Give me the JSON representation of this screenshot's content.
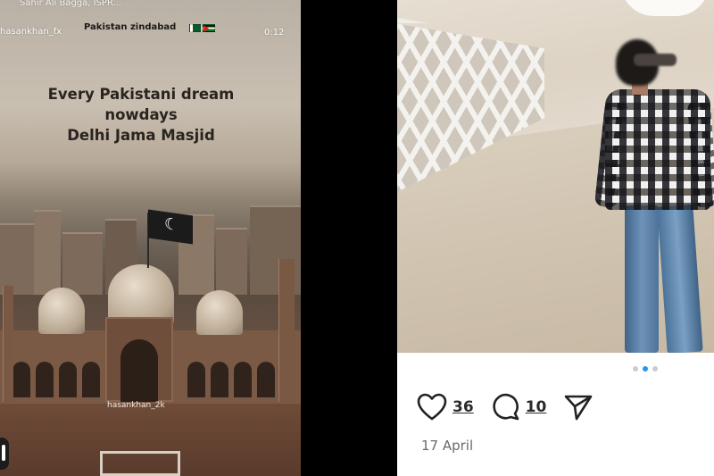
{
  "story": {
    "music_line": "Sahir Ali Bagga, ISPR...",
    "username": "hasankhan_fx",
    "caption": "Pakistan zindabad",
    "time": "0:12",
    "headline": [
      "Every Pakistani dream",
      "nowdays",
      "Delhi Jama Masjid"
    ],
    "watermark": "hasankhan_2k",
    "flag_icons": [
      "pakistan-flag-icon",
      "palestine-flag-icon"
    ]
  },
  "post": {
    "carousel": {
      "total": 3,
      "active_index": 1
    },
    "likes": "36",
    "comments": "10",
    "date": "17 April",
    "accent_color": "#2196f3"
  }
}
